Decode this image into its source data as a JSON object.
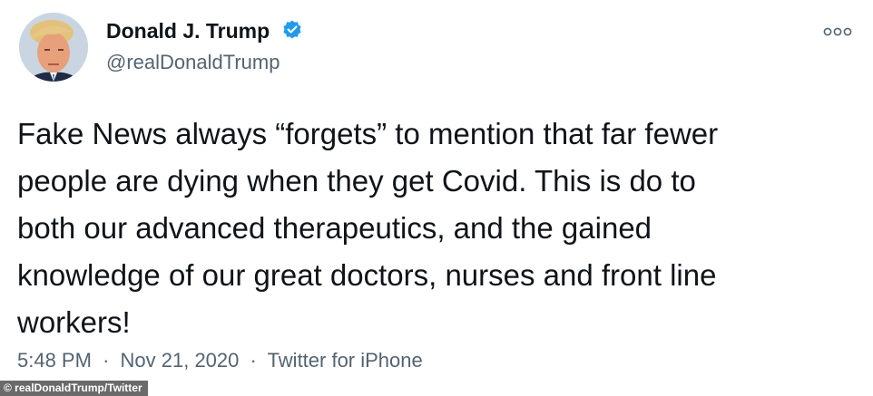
{
  "tweet": {
    "author": {
      "display_name": "Donald J. Trump",
      "handle": "@realDonaldTrump",
      "verified": true
    },
    "text": "Fake News always “forgets” to mention that far fewer\npeople are dying when they get Covid. This is do to\nboth our advanced therapeutics, and the gained\nknowledge of our great doctors, nurses and front line\nworkers!",
    "time": "5:48 PM",
    "separator": "·",
    "date": "Nov 21, 2020",
    "source": "Twitter for iPhone"
  },
  "watermark": "© realDonaldTrump/Twitter",
  "icons": {
    "more": "more-options-icon",
    "verified": "verified-badge-icon",
    "avatar": "avatar"
  },
  "colors": {
    "text": "#0f1419",
    "secondary": "#536471",
    "verified": "#1d9bf0"
  }
}
